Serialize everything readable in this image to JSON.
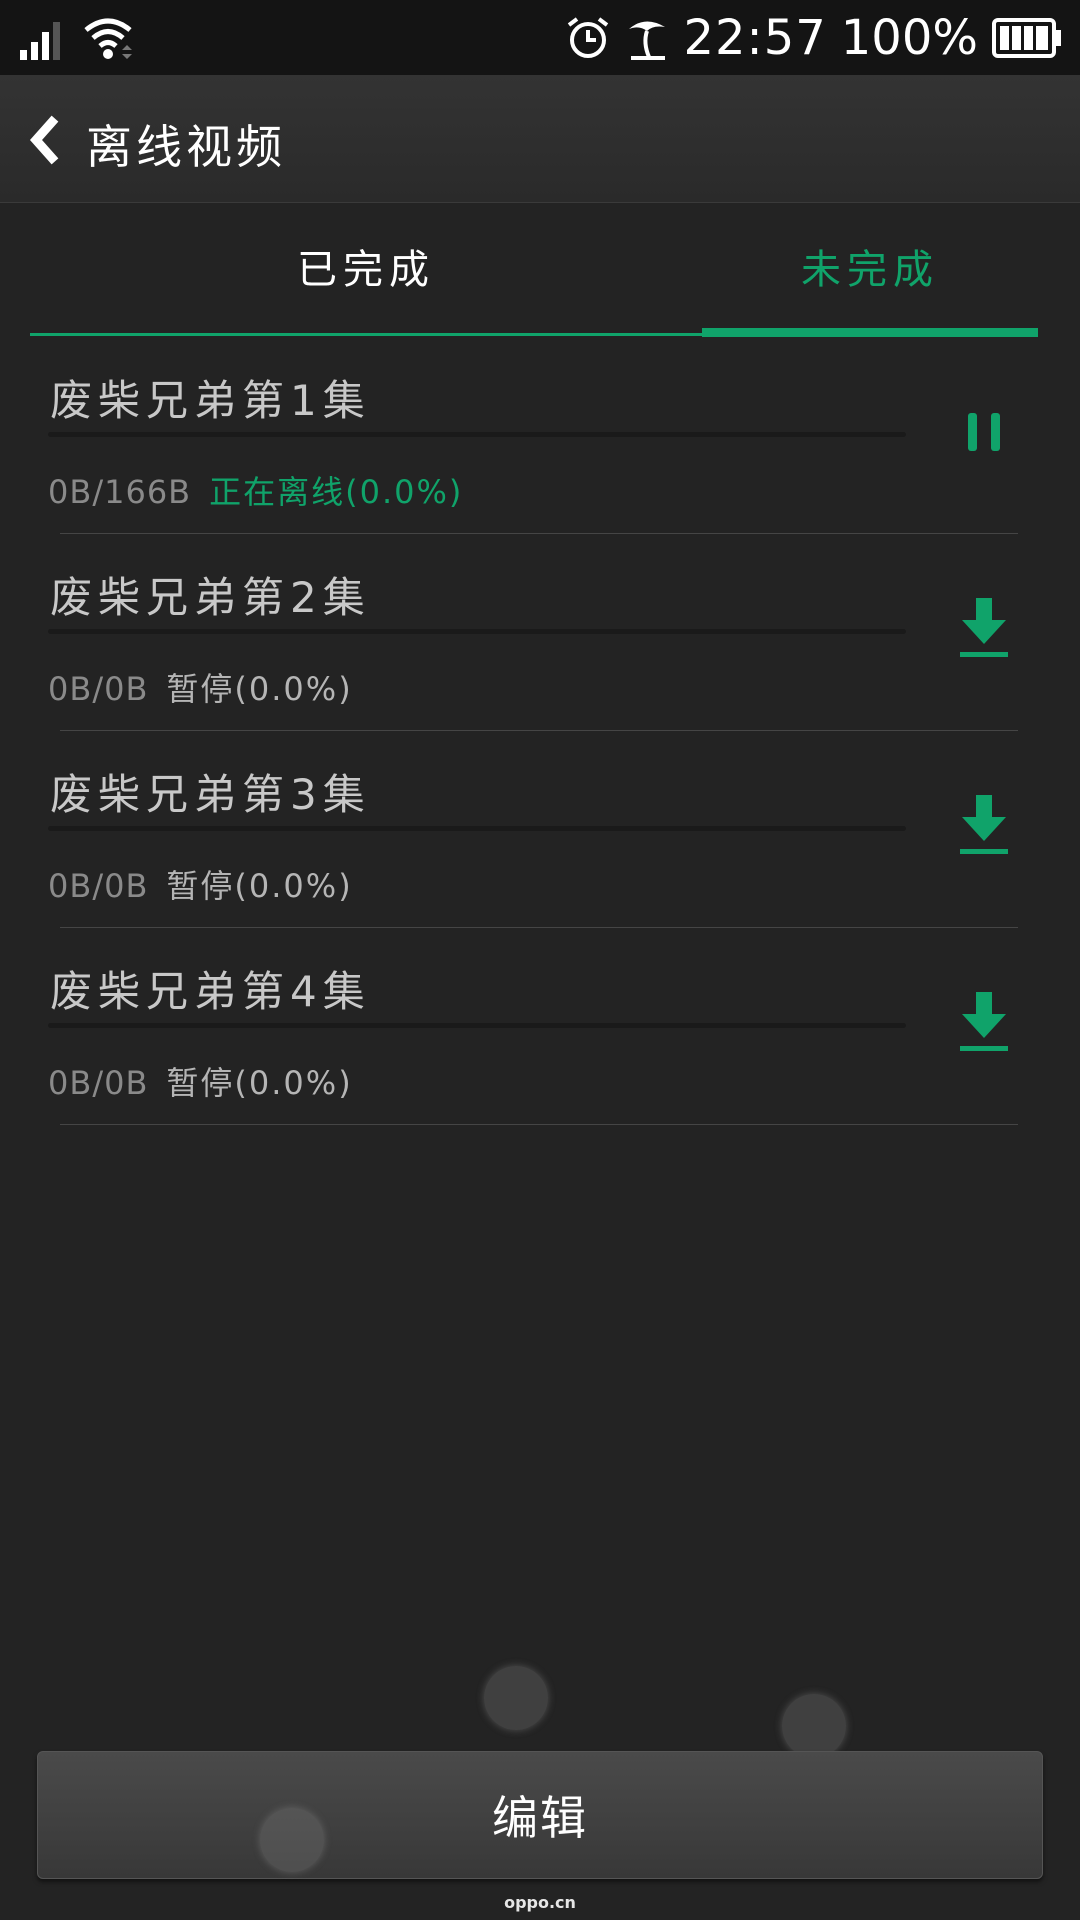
{
  "status_bar": {
    "time": "22:57",
    "battery_percent": "100%",
    "icons": [
      "signal-icon",
      "wifi-icon",
      "alarm-icon",
      "beach-icon",
      "battery-icon"
    ]
  },
  "header": {
    "title": "离线视频",
    "back_icon": "chevron-left-icon"
  },
  "tabs": [
    {
      "label": "已完成",
      "active": false
    },
    {
      "label": "未完成",
      "active": true
    }
  ],
  "downloads": [
    {
      "title": "废柴兄弟第1集",
      "size": "0B/166B",
      "status": "正在离线(0.0%)",
      "progress": 0.0,
      "action_icon": "pause-icon"
    },
    {
      "title": "废柴兄弟第2集",
      "size": "0B/0B",
      "status": "暂停(0.0%)",
      "progress": 0.0,
      "action_icon": "download-icon"
    },
    {
      "title": "废柴兄弟第3集",
      "size": "0B/0B",
      "status": "暂停(0.0%)",
      "progress": 0.0,
      "action_icon": "download-icon"
    },
    {
      "title": "废柴兄弟第4集",
      "size": "0B/0B",
      "status": "暂停(0.0%)",
      "progress": 0.0,
      "action_icon": "download-icon"
    }
  ],
  "footer": {
    "edit_label": "编辑",
    "watermark": "oppo.cn"
  },
  "colors": {
    "accent": "#10a36a",
    "background": "#232323",
    "status_bar": "#141414"
  }
}
